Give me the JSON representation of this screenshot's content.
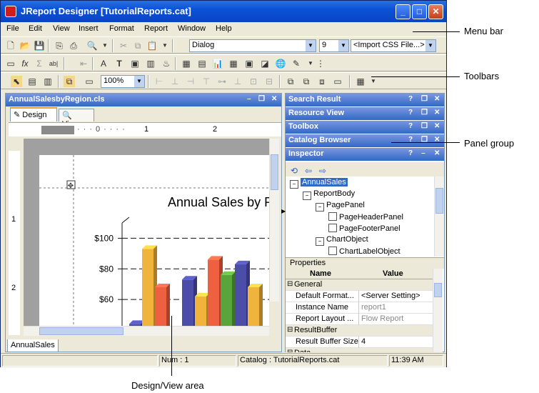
{
  "window": {
    "title": "JReport Designer [TutorialReports.cat]"
  },
  "menubar": {
    "items": [
      "File",
      "Edit",
      "View",
      "Insert",
      "Format",
      "Report",
      "Window",
      "Help"
    ]
  },
  "toolbar1": {
    "font": "Dialog",
    "size": "9",
    "css": "<Import CSS File...>"
  },
  "toolbar3": {
    "zoom": "100%"
  },
  "design_pane": {
    "title": "AnnualSalesbyRegion.cls",
    "tabs": [
      "Design",
      "View"
    ],
    "bottom_tab": "AnnualSales",
    "ruler_labels": [
      "1",
      "2"
    ],
    "vruler_labels": [
      "1",
      "2"
    ]
  },
  "chart_data": {
    "type": "bar",
    "title": "Annual Sales by R",
    "ytick_labels": [
      "$100",
      "$80",
      "$60"
    ],
    "ylim": [
      40,
      110
    ],
    "series_colors": [
      "#4b4da8",
      "#f0b43c",
      "#ee6040",
      "#5aa43c"
    ],
    "groups": [
      [
        44,
        93,
        68
      ],
      [
        73,
        62,
        86,
        76
      ],
      [
        83,
        68
      ]
    ],
    "group_colors": [
      [
        "#4b4da8",
        "#f0b43c",
        "#ee6040"
      ],
      [
        "#4b4da8",
        "#f0b43c",
        "#ee6040",
        "#5aa43c"
      ],
      [
        "#4b4da8",
        "#f0b43c"
      ]
    ]
  },
  "right_panels": [
    "Search Result",
    "Resource View",
    "Toolbox",
    "Catalog Browser",
    "Inspector"
  ],
  "inspector": {
    "tree": [
      {
        "label": "AnnualSales",
        "depth": 0,
        "selected": true
      },
      {
        "label": "ReportBody",
        "depth": 1
      },
      {
        "label": "PagePanel",
        "depth": 2
      },
      {
        "label": "PageHeaderPanel",
        "depth": 3
      },
      {
        "label": "PageFooterPanel",
        "depth": 3
      },
      {
        "label": "ChartObject",
        "depth": 2
      },
      {
        "label": "ChartLabelObject",
        "depth": 3
      }
    ],
    "properties_title": "Properties",
    "columns": [
      "Name",
      "Value"
    ],
    "rows": [
      {
        "name": "General",
        "value": "",
        "group": true
      },
      {
        "name": "Default Format...",
        "value": "<Server Setting>"
      },
      {
        "name": "Instance Name",
        "value": "report1",
        "muted": true
      },
      {
        "name": "Report Layout ...",
        "value": "Flow Report",
        "muted": true
      },
      {
        "name": "ResultBuffer",
        "value": "",
        "group": true
      },
      {
        "name": "Result Buffer Size",
        "value": "4"
      },
      {
        "name": "Data",
        "value": "",
        "group": true
      }
    ]
  },
  "statusbar": {
    "num": "Num : 1",
    "catalog": "Catalog : TutorialReports.cat",
    "time": "11:39 AM"
  },
  "callouts": {
    "menu_bar": "Menu bar",
    "toolbars": "Toolbars",
    "panel_group": "Panel group",
    "design_view": "Design/View area"
  }
}
